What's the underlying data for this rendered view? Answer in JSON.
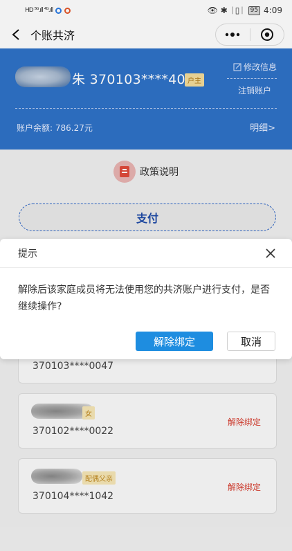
{
  "status_bar": {
    "left_text": "HD ⁵ᴳ.ıll ⁴ᴳ.ıll",
    "right_icons": "👁 ✱ ᛁ▯ᛁ",
    "battery": "95",
    "time": "4:09"
  },
  "nav": {
    "title": "个账共济"
  },
  "account": {
    "id_masked": "朱 370103****4016",
    "role_badge": "户主",
    "edit_label": "修改信息",
    "cancel_account_label": "注销账户",
    "balance_label": "账户余额:  786.27元",
    "detail_label": "明细>"
  },
  "policy_label": "政策说明",
  "pay_label": "支付",
  "members": [
    {
      "id": "370103****0047",
      "badge": "",
      "unbind": ""
    },
    {
      "id": "370102****0022",
      "badge": "女",
      "unbind": "解除绑定"
    },
    {
      "id": "370104****1042",
      "badge": "配偶父亲",
      "unbind": "解除绑定"
    }
  ],
  "dialog": {
    "title": "提示",
    "message": "解除后该家庭成员将无法使用您的共济账户进行支付，是否继续操作?",
    "confirm_label": "解除绑定",
    "cancel_label": "取消"
  },
  "colors": {
    "card_blue": "#2f72c8",
    "confirm_blue": "#1e8de0",
    "unbind_red": "#d63a2c"
  }
}
